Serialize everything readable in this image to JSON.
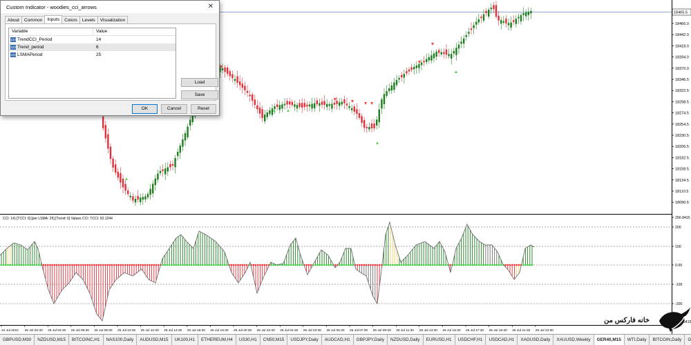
{
  "dialog": {
    "title": "Custom Indicator - woodies_cci_arrows",
    "close_glyph": "✕",
    "tabs": [
      "About",
      "Common",
      "Inputs",
      "Colors",
      "Levels",
      "Visualization"
    ],
    "active_tab": "Inputs",
    "table_headers": [
      "Variable",
      "Value"
    ],
    "params": [
      {
        "name": "TrendCCI_Period",
        "value": "14"
      },
      {
        "name": "Trend_period",
        "value": "6"
      },
      {
        "name": "LSMAPeriod",
        "value": "25"
      }
    ],
    "param_icon": "123",
    "buttons": {
      "load": "Load",
      "save": "Save",
      "ok": "OK",
      "cancel": "Cancel",
      "reset": "Reset"
    }
  },
  "price_chart": {
    "price_axis": [
      "18466.0",
      "18442.0",
      "18418.0",
      "18394.0",
      "18370.0",
      "18346.5",
      "18322.5",
      "18298.5",
      "18274.5",
      "18254.5",
      "18230.5",
      "18206.5",
      "18182.5",
      "18158.5",
      "18134.5",
      "18110.5",
      "18090.5"
    ],
    "current_price": "18465.5",
    "colors": {
      "bull": "#1e7d1e",
      "bear": "#e0303a",
      "arrow_up": "#5fd35f",
      "arrow_down": "#ff4040",
      "price_line": "#6b8cc4"
    }
  },
  "indicator": {
    "header": "CCI: 14) [TCCI: 6] [per LSMA: 25] [Trend: 6] Values CCI: TCCI: 92.1244",
    "axis": [
      "256.8415",
      "200",
      "100",
      "0.00",
      "-100",
      "-200",
      "-256.8415"
    ],
    "colors": {
      "pos": "#1e7d1e",
      "neg": "#e0303a",
      "neutral": "#f3d36b",
      "gray": "#6e6e6e",
      "zero_pos": "#33cc33",
      "zero_neg": "#ff3030"
    }
  },
  "time_axis": [
    "24 Jul 2024",
    "25 Jul 02:30",
    "25 Jul 04:30",
    "25 Jul 06:30",
    "25 Jul 08:30",
    "25 Jul 10:30",
    "25 Jul 12:30",
    "25 Jul 14:30",
    "25 Jul 16:30",
    "25 Jul 18:30",
    "25 Jul 20:30",
    "25 Jul 22:30",
    "26 Jul 01:30",
    "26 Jul 03:30",
    "26 Jul 05:30",
    "26 Jul 07:30",
    "26 Jul 09:30",
    "26 Jul 11:30",
    "26 Jul 13:30",
    "26 Jul 15:30",
    "26 Jul 17:30",
    "26 Jul 19:30",
    "26 Jul 21:30",
    "26 Jul 23:30"
  ],
  "symbol_tabs": [
    "GBPUSD,M30",
    "NZDUSD,M15",
    "BITCOINC,H1",
    "NAS100,Daily",
    "AUDUSD,M15",
    "UK100,H1",
    "ETHEREUM,H4",
    "US30,H1",
    "CN50,M15",
    "USDJPY,Daily",
    "AUDCAD,H1",
    "GBPJPY,Daily",
    "NZDUSD,Daily",
    "EURUSD,H1",
    "USDCHF,H1",
    "USDCAD,H1",
    "XAGUSD,Daily",
    "XAUUSD,Weekly",
    "GER40,M15",
    "WTI,Daily",
    "BITCOIN,Daily",
    "GBP"
  ],
  "active_symbol": "GER40,M15",
  "logo": {
    "text": "خانه فارکس من",
    "icon": "bull-logo-icon"
  }
}
